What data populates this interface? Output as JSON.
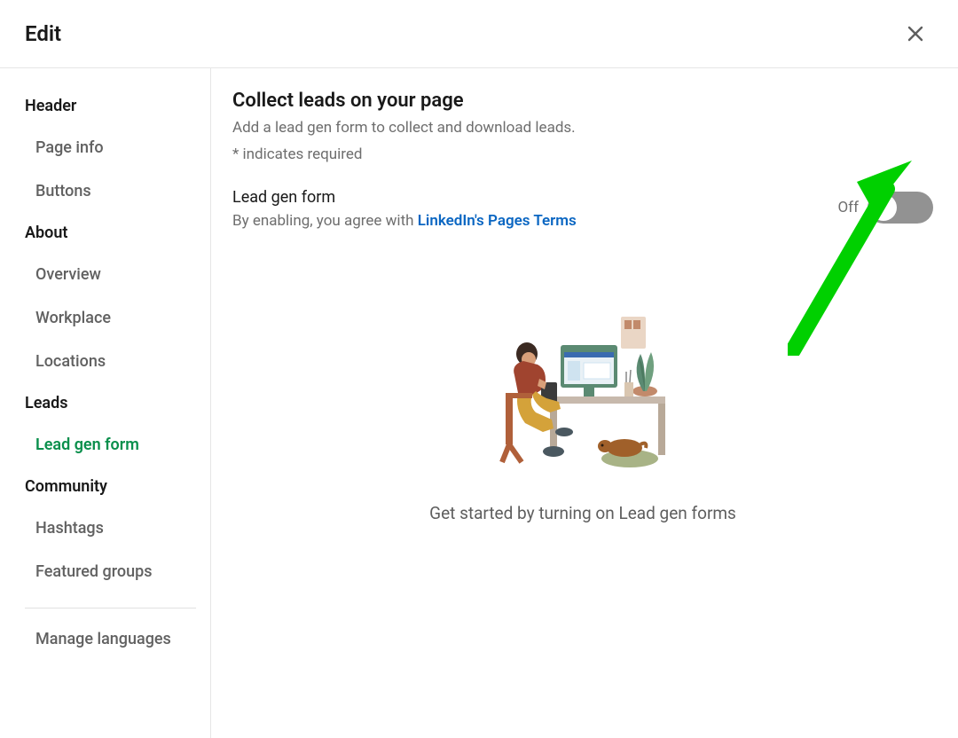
{
  "modal": {
    "title": "Edit"
  },
  "sidebar": {
    "sections": [
      {
        "label": "Header",
        "items": [
          "Page info",
          "Buttons"
        ]
      },
      {
        "label": "About",
        "items": [
          "Overview",
          "Workplace",
          "Locations"
        ]
      },
      {
        "label": "Leads",
        "items": [
          "Lead gen form"
        ],
        "active_index": 0
      },
      {
        "label": "Community",
        "items": [
          "Hashtags",
          "Featured groups"
        ]
      }
    ],
    "footer_item": "Manage languages"
  },
  "content": {
    "title": "Collect leads on your page",
    "description": "Add a lead gen form to collect and download leads.",
    "required_note": "*  indicates required",
    "form": {
      "label": "Lead gen form",
      "subtext_prefix": "By enabling, you agree with ",
      "terms_link_text": "LinkedIn's Pages Terms",
      "toggle_state": "Off"
    },
    "empty_state_text": "Get started by turning on Lead gen forms"
  }
}
